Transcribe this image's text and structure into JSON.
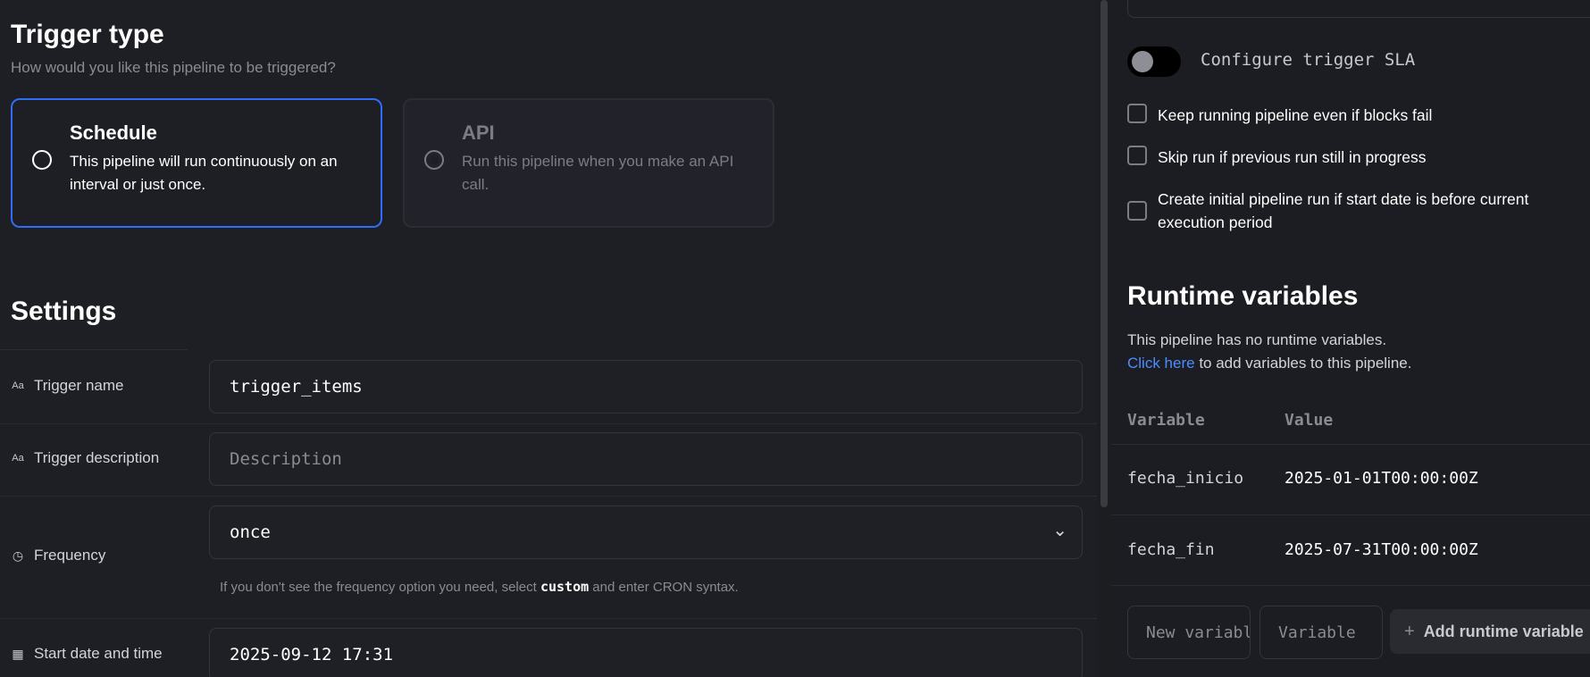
{
  "trigger_type": {
    "title": "Trigger type",
    "subtitle": "How would you like this pipeline to be triggered?",
    "options": [
      {
        "title": "Schedule",
        "description": "This pipeline will run continuously on an interval or just once.",
        "selected": true
      },
      {
        "title": "API",
        "description": "Run this pipeline when you make an API call.",
        "selected": false
      }
    ]
  },
  "settings": {
    "title": "Settings",
    "trigger_name": {
      "label": "Trigger name",
      "value": "trigger_items",
      "icon": "text-type-icon"
    },
    "trigger_description": {
      "label": "Trigger description",
      "placeholder": "Description",
      "icon": "text-type-icon"
    },
    "frequency": {
      "label": "Frequency",
      "value": "once",
      "icon": "clock-icon",
      "help_prefix": "If you don't see the frequency option you need, select ",
      "help_code": "custom",
      "help_suffix": " and enter CRON syntax."
    },
    "start_date": {
      "label": "Start date and time",
      "value": "2025-09-12 17:31",
      "icon": "calendar-icon"
    }
  },
  "sla": {
    "label": "Configure trigger SLA",
    "enabled": false
  },
  "checkboxes": [
    {
      "label": "Keep running pipeline even if blocks fail",
      "checked": false
    },
    {
      "label": "Skip run if previous run still in progress",
      "checked": false
    },
    {
      "label": "Create initial pipeline run if start date is before current execution period",
      "checked": false
    }
  ],
  "runtime_variables": {
    "title": "Runtime variables",
    "note": "This pipeline has no runtime variables.",
    "link": "Click here",
    "link_suffix": " to add variables to this pipeline.",
    "headers": {
      "variable": "Variable",
      "value": "Value"
    },
    "rows": [
      {
        "variable": "fecha_inicio",
        "value": "2025-01-01T00:00:00Z"
      },
      {
        "variable": "fecha_fin",
        "value": "2025-07-31T00:00:00Z"
      }
    ],
    "new_variable_placeholder": "New variable",
    "value_placeholder": "Variable",
    "add_button": "Add runtime variable"
  },
  "colors": {
    "accent": "#2f6df6",
    "link": "#4d8cff",
    "background": "#1e1f24"
  }
}
